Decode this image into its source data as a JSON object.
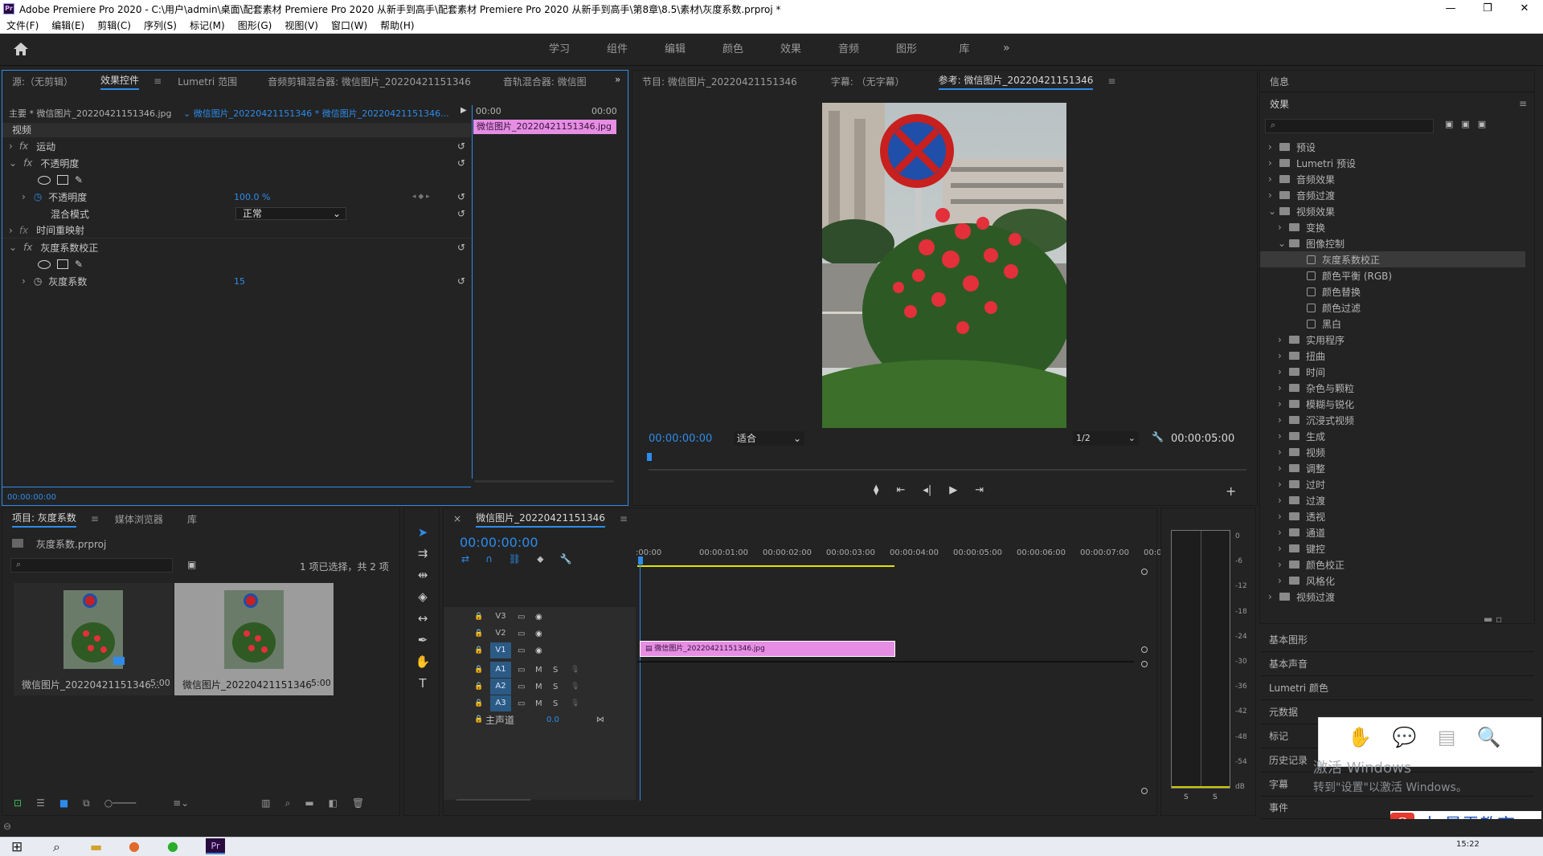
{
  "window": {
    "title": "Adobe Premiere Pro 2020 - C:\\用户\\admin\\桌面\\配套素材 Premiere Pro 2020 从新手到高手\\配套素材 Premiere Pro 2020 从新手到高手\\第8章\\8.5\\素材\\灰度系数.prproj *",
    "app_icon": "Pr"
  },
  "menu": [
    "文件(F)",
    "编辑(E)",
    "剪辑(C)",
    "序列(S)",
    "标记(M)",
    "图形(G)",
    "视图(V)",
    "窗口(W)",
    "帮助(H)"
  ],
  "workspaces": [
    "学习",
    "组件",
    "编辑",
    "颜色",
    "效果",
    "音频",
    "图形",
    "库"
  ],
  "source_panel": {
    "tabs": [
      "源:（无剪辑）",
      "效果控件",
      "Lumetri 范围",
      "音频剪辑混合器: 微信图片_20220421151346",
      "音轨混合器: 微信图"
    ],
    "master": "主要 * 微信图片_20220421151346.jpg",
    "sequence": "微信图片_20220421151346 * 微信图片_20220421151346...",
    "ruler_start": "00:00",
    "ruler_end": "00:00",
    "clip_label": "微信图片_20220421151346.jpg",
    "section_video": "视频",
    "motion": "运动",
    "opacity": "不透明度",
    "opacity_param": "不透明度",
    "opacity_value": "100.0 %",
    "blend_mode": "混合模式",
    "blend_value": "正常",
    "time_remap": "时间重映射",
    "gamma_effect": "灰度系数校正",
    "gamma_param": "灰度系数",
    "gamma_value": "15",
    "timecode": "00:00:00:00"
  },
  "program_panel": {
    "tabs": [
      "节目: 微信图片_20220421151346",
      "字幕: （无字幕）",
      "参考: 微信图片_20220421151346"
    ],
    "timecode_in": "00:00:00:00",
    "fit": "适合",
    "resolution": "1/2",
    "timecode_dur": "00:00:05:00"
  },
  "project_panel": {
    "tabs": [
      "项目: 灰度系数",
      "媒体浏览器",
      "库"
    ],
    "file": "灰度系数.prproj",
    "selection": "1 项已选择，共 2 项",
    "items": [
      {
        "name": "微信图片_20220421151346...",
        "dur": "5:00"
      },
      {
        "name": "微信图片_20220421151346",
        "dur": "5:00"
      }
    ]
  },
  "timeline": {
    "tab": "微信图片_20220421151346",
    "timecode": "00:00:00:00",
    "ruler": [
      ":00:00",
      "00:00:01:00",
      "00:00:02:00",
      "00:00:03:00",
      "00:00:04:00",
      "00:00:05:00",
      "00:00:06:00",
      "00:00:07:00",
      "00:00:0"
    ],
    "tracks": [
      {
        "name": "V3"
      },
      {
        "name": "V2"
      },
      {
        "name": "V1"
      },
      {
        "name": "A1"
      },
      {
        "name": "A2"
      },
      {
        "name": "A3"
      }
    ],
    "master_label": "主声道",
    "master_value": "0.0",
    "clip": "微信图片_20220421151346.jpg",
    "mute": "M",
    "solo": "S"
  },
  "meter": {
    "labels": [
      "0",
      "-6",
      "-12",
      "-18",
      "-24",
      "-30",
      "-36",
      "-42",
      "-48",
      "-54",
      "dB"
    ],
    "solo": "S"
  },
  "right_panel": {
    "info": "信息",
    "effects": "效果",
    "tree": [
      {
        "label": "预设",
        "depth": 0,
        "type": "folder",
        "open": false
      },
      {
        "label": "Lumetri 预设",
        "depth": 0,
        "type": "folder",
        "open": false
      },
      {
        "label": "音频效果",
        "depth": 0,
        "type": "folder",
        "open": false
      },
      {
        "label": "音频过渡",
        "depth": 0,
        "type": "folder",
        "open": false
      },
      {
        "label": "视频效果",
        "depth": 0,
        "type": "folder",
        "open": true
      },
      {
        "label": "变换",
        "depth": 1,
        "type": "folder",
        "open": false
      },
      {
        "label": "图像控制",
        "depth": 1,
        "type": "folder",
        "open": true
      },
      {
        "label": "灰度系数校正",
        "depth": 2,
        "type": "preset",
        "selected": true
      },
      {
        "label": "颜色平衡 (RGB)",
        "depth": 2,
        "type": "preset"
      },
      {
        "label": "颜色替换",
        "depth": 2,
        "type": "preset"
      },
      {
        "label": "颜色过滤",
        "depth": 2,
        "type": "preset"
      },
      {
        "label": "黑白",
        "depth": 2,
        "type": "preset"
      },
      {
        "label": "实用程序",
        "depth": 1,
        "type": "folder",
        "open": false
      },
      {
        "label": "扭曲",
        "depth": 1,
        "type": "folder",
        "open": false
      },
      {
        "label": "时间",
        "depth": 1,
        "type": "folder",
        "open": false
      },
      {
        "label": "杂色与颗粒",
        "depth": 1,
        "type": "folder",
        "open": false
      },
      {
        "label": "模糊与锐化",
        "depth": 1,
        "type": "folder",
        "open": false
      },
      {
        "label": "沉浸式视频",
        "depth": 1,
        "type": "folder",
        "open": false
      },
      {
        "label": "生成",
        "depth": 1,
        "type": "folder",
        "open": false
      },
      {
        "label": "视频",
        "depth": 1,
        "type": "folder",
        "open": false
      },
      {
        "label": "调整",
        "depth": 1,
        "type": "folder",
        "open": false
      },
      {
        "label": "过时",
        "depth": 1,
        "type": "folder",
        "open": false
      },
      {
        "label": "过渡",
        "depth": 1,
        "type": "folder",
        "open": false
      },
      {
        "label": "透视",
        "depth": 1,
        "type": "folder",
        "open": false
      },
      {
        "label": "通道",
        "depth": 1,
        "type": "folder",
        "open": false
      },
      {
        "label": "键控",
        "depth": 1,
        "type": "folder",
        "open": false
      },
      {
        "label": "颜色校正",
        "depth": 1,
        "type": "folder",
        "open": false
      },
      {
        "label": "风格化",
        "depth": 1,
        "type": "folder",
        "open": false
      },
      {
        "label": "视频过渡",
        "depth": 0,
        "type": "folder",
        "open": false
      }
    ],
    "sections": [
      "基本图形",
      "基本声音",
      "Lumetri 颜色",
      "元数据",
      "标记",
      "历史记录",
      "字幕",
      "事件"
    ]
  },
  "watermark": {
    "line1": "激活 Windows",
    "line2": "转到\"设置\"以激活 Windows。",
    "brand": "中 最需教育"
  },
  "taskbar": {
    "time": "15:22"
  }
}
